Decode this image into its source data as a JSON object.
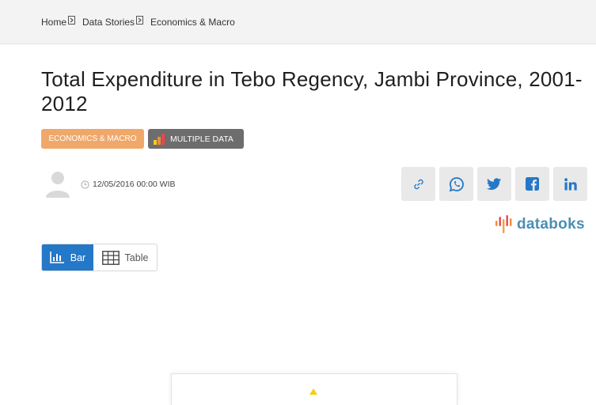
{
  "breadcrumb": {
    "items": [
      "Home",
      "Data Stories",
      "Economics & Macro"
    ]
  },
  "article": {
    "title": "Total Expenditure in Tebo Regency, Jambi Province, 2001-2012",
    "category_tag": "ECONOMICS & MACRO",
    "data_tag": "MULTIPLE DATA",
    "published": "12/05/2016 00:00 WIB"
  },
  "share": {
    "icons": [
      "link-icon",
      "whatsapp-icon",
      "twitter-icon",
      "facebook-icon",
      "linkedin-icon"
    ]
  },
  "brand": {
    "name": "databoks"
  },
  "view_toggle": {
    "bar_label": "Bar",
    "table_label": "Table",
    "active": "Bar"
  },
  "colors": {
    "accent_blue": "#2478c8",
    "category_orange": "#f0a86a",
    "multi_gray": "#6d6d6d",
    "brand_blue": "#4a8fb5",
    "share_bg": "#e9e9e9",
    "topbar_bg": "#f3f3f3"
  }
}
